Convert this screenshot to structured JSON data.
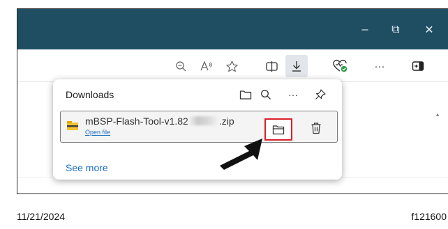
{
  "window_controls": {
    "minimize": "–",
    "restore": "⧉",
    "close": "✕"
  },
  "toolbar": {
    "icons": [
      "zoom-out-icon",
      "read-aloud-icon",
      "favorite-star-icon",
      "split-screen-icon",
      "downloads-icon",
      "browser-essentials-icon",
      "more-icon",
      "sidebar-icon"
    ],
    "more_label": "···"
  },
  "downloads_panel": {
    "title": "Downloads",
    "header_icons": [
      "open-downloads-folder-icon",
      "search-icon",
      "more-options-icon",
      "pin-icon"
    ],
    "more_label": "···",
    "item": {
      "filename_start": "mBSP-Flash-Tool-v1.82",
      "filename_end": ".zip",
      "open_file": "Open file"
    },
    "see_more": "See more"
  },
  "colors": {
    "titlebar": "#1f4e63",
    "highlight": "#d9202a",
    "link": "#1a6fc0"
  },
  "footer": {
    "date": "11/21/2024",
    "figure_id": "f121600"
  }
}
